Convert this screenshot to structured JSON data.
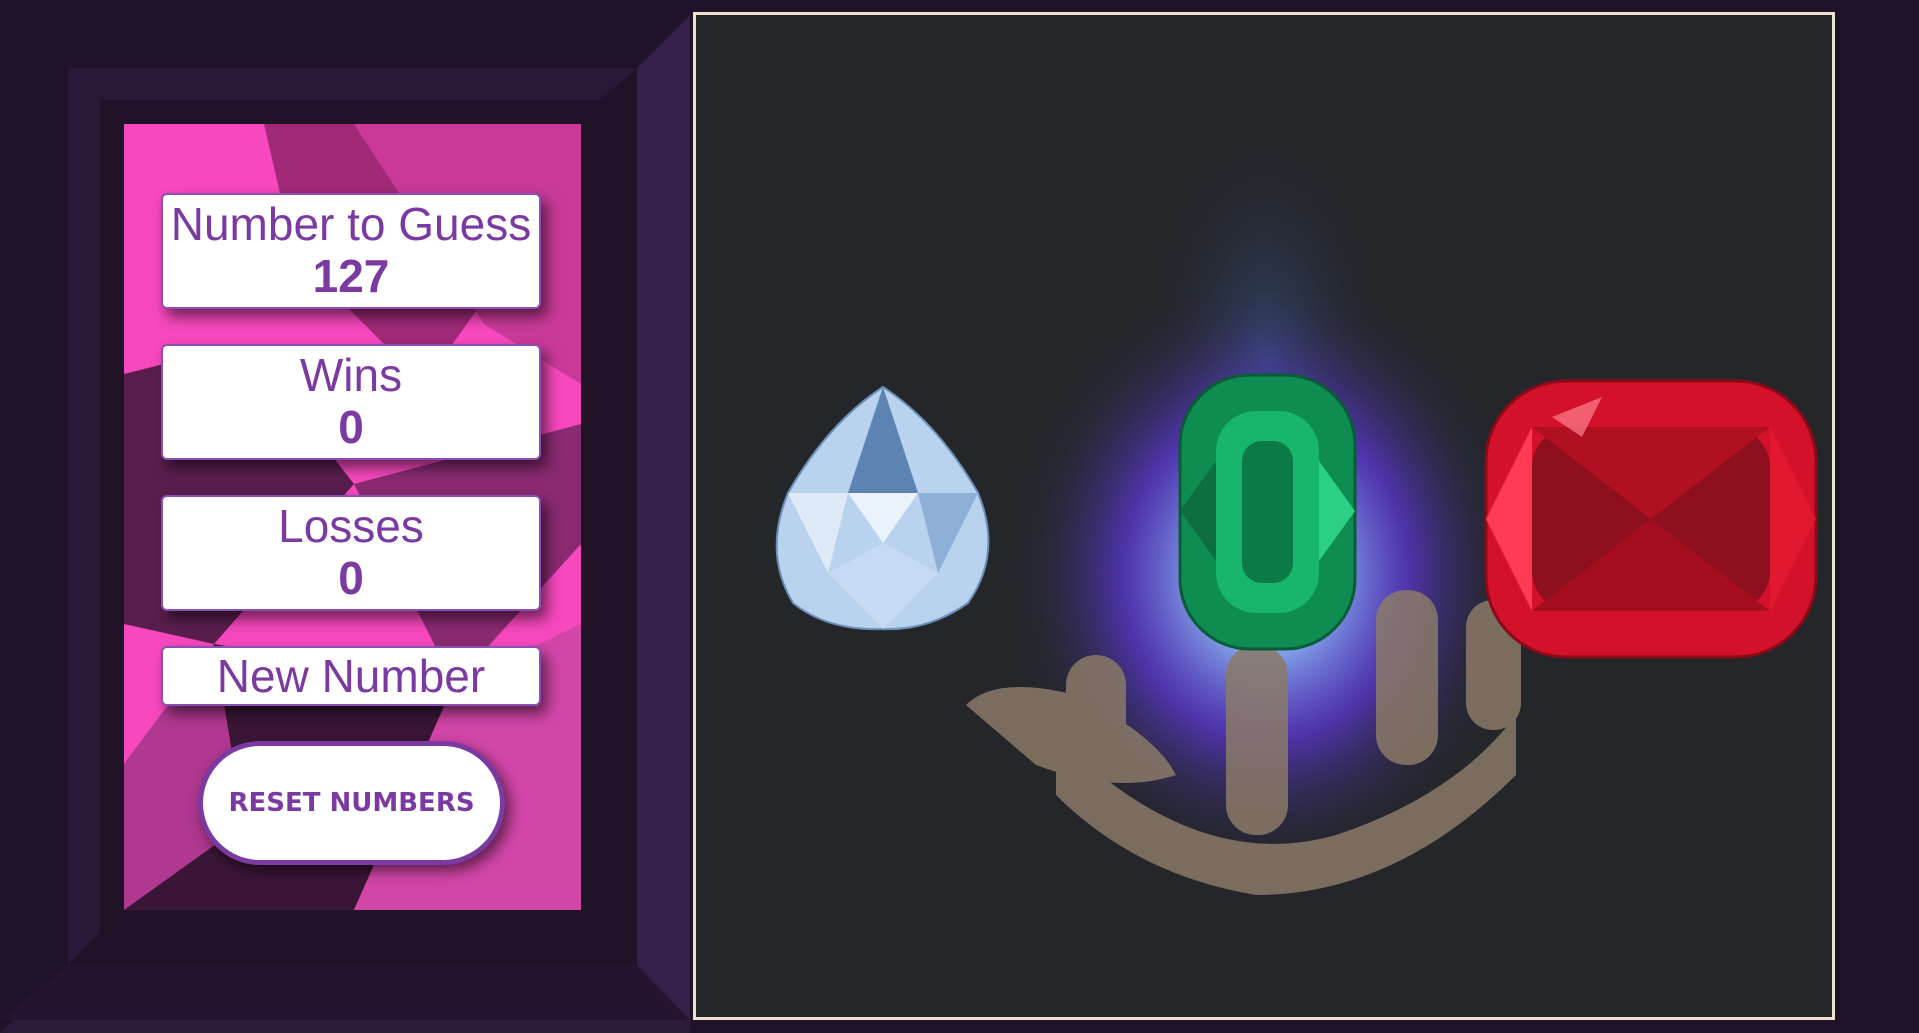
{
  "score_panel": {
    "target": {
      "label": "Number to Guess",
      "value": "127"
    },
    "wins": {
      "label": "Wins",
      "value": "0"
    },
    "losses": {
      "label": "Losses",
      "value": "0"
    },
    "new_number_label": "New Number",
    "reset_label": "RESET NUMBERS"
  },
  "gems": [
    {
      "name": "diamond",
      "color": "#a9c6e8"
    },
    {
      "name": "emerald",
      "color": "#13a463"
    },
    {
      "name": "ruby",
      "color": "#d3112a"
    }
  ],
  "colors": {
    "page_bg": "#1f1329",
    "panel_pink": "#f748be",
    "text_purple": "#7a3aa2",
    "stage_bg": "#24262a",
    "stage_border": "#ede3cf"
  }
}
